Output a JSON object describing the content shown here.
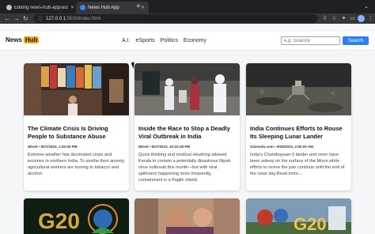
{
  "browser": {
    "tabs": [
      {
        "title": "Editing news-hub-app/assets..."
      },
      {
        "title": "News Hub App"
      }
    ],
    "url_host": "127.0.0.1",
    "url_rest": ":5500/index.html"
  },
  "site": {
    "logo_news": "News",
    "logo_hub": "Hub",
    "menu": [
      "A.I.",
      "eSports",
      "Politics",
      "Economy"
    ],
    "search_placeholder": "e.g. Science",
    "search_button": "Search"
  },
  "cards": [
    {
      "title": "The Climate Crisis Is Driving People to Substance Abuse",
      "meta": "Wired • 9/27/2023, 1:30:00 PM",
      "desc": "Extreme weather has decimated crops and incomes in northern India. To soothe their anxiety, agricultural workers are turning to tobacco and alcohol."
    },
    {
      "title": "Inside the Race to Stop a Deadly Viral Outbreak in India",
      "meta": "Wired • 9/27/2023, 10:33:49 PM",
      "desc": "Quick thinking and medical sleuthing allowed Kerala to contain a potentially disastrous Nipah virus outbreak this month—but with viral spillovers happening more frequently, containment is a fragile shield."
    },
    {
      "title": "India Continues Efforts to Rouse Its Sleeping Lunar Lander",
      "meta": "Gizmodo.com • 9/26/2023, 2:50:00 AM",
      "desc": "India's Chandrayaan-3 lander and rover have been asleep on the surface of the Moon while efforts to revive the pair continue until the end of the lunar day.Read more..."
    }
  ],
  "row2_texts": [
    "G20",
    "G20"
  ],
  "colors": {
    "accent": "#2f80ed",
    "logo_badge": "#f5b400"
  }
}
